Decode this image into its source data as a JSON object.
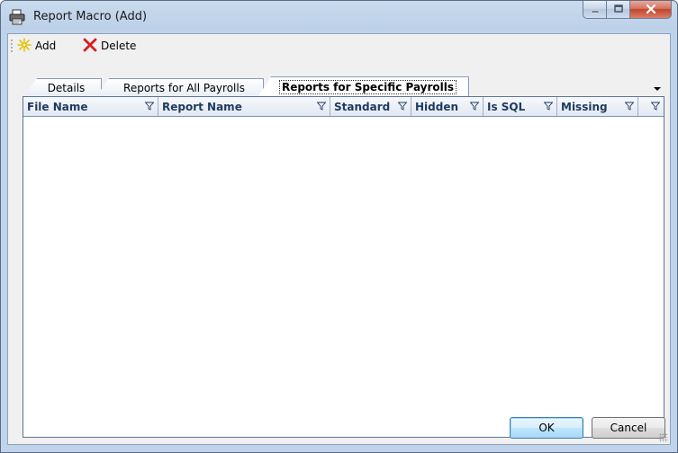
{
  "window": {
    "title": "Report Macro (Add)"
  },
  "toolbar": {
    "add_label": "Add",
    "delete_label": "Delete"
  },
  "tabs": [
    {
      "label": "Details",
      "active": false
    },
    {
      "label": "Reports for All Payrolls",
      "active": false
    },
    {
      "label": "Reports for Specific Payrolls",
      "active": true
    }
  ],
  "grid": {
    "columns": [
      {
        "label": "File Name"
      },
      {
        "label": "Report Name"
      },
      {
        "label": "Standard"
      },
      {
        "label": "Hidden"
      },
      {
        "label": "Is SQL"
      },
      {
        "label": "Missing"
      },
      {
        "label": ""
      }
    ],
    "rows": []
  },
  "buttons": {
    "ok_label": "OK",
    "cancel_label": "Cancel"
  },
  "icons": {
    "title": "printer-icon",
    "add": "sparkle-add-icon",
    "delete": "red-x-icon",
    "filter": "funnel-filter-icon",
    "minimize": "minimize-icon",
    "maximize": "maximize-icon",
    "close": "close-icon"
  },
  "colors": {
    "title_gradient": "#c9dbee",
    "grid_header_text": "#1e3a5f",
    "close_button": "#c2452c",
    "delete_icon": "#d42020",
    "add_icon": "#e8c400"
  }
}
